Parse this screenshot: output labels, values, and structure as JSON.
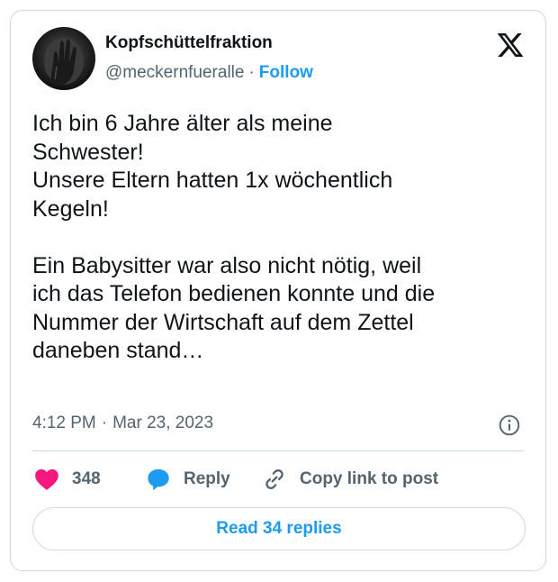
{
  "author": {
    "display_name": "Kopfschüttelfraktion",
    "handle": "@meckernfueralle",
    "separator": "·",
    "follow_label": "Follow",
    "avatar_icon": "hand-over-face-avatar"
  },
  "brand_icon": "x-logo-icon",
  "tweet": {
    "lines": [
      "Ich bin 6 Jahre älter als meine",
      "Schwester!",
      "Unsere Eltern hatten 1x wöchentlich",
      "Kegeln!",
      "",
      "Ein Babysitter war also nicht nötig, weil",
      "ich das Telefon bedienen konnte und die",
      "Nummer der Wirtschaft auf dem Zettel",
      "daneben stand…"
    ]
  },
  "meta": {
    "time": "4:12 PM",
    "separator": "·",
    "date": "Mar 23, 2023",
    "info_icon": "info-icon"
  },
  "actions": {
    "like_count": "348",
    "like_icon": "heart-icon",
    "reply_label": "Reply",
    "reply_icon": "speech-bubble-icon",
    "copy_label": "Copy link to post",
    "copy_icon": "link-icon"
  },
  "read_replies_label": "Read 34 replies",
  "colors": {
    "accent": "#1d9bf0",
    "like": "#f91880",
    "text": "#0f1419",
    "secondary": "#536471",
    "border": "#cfd9de"
  }
}
